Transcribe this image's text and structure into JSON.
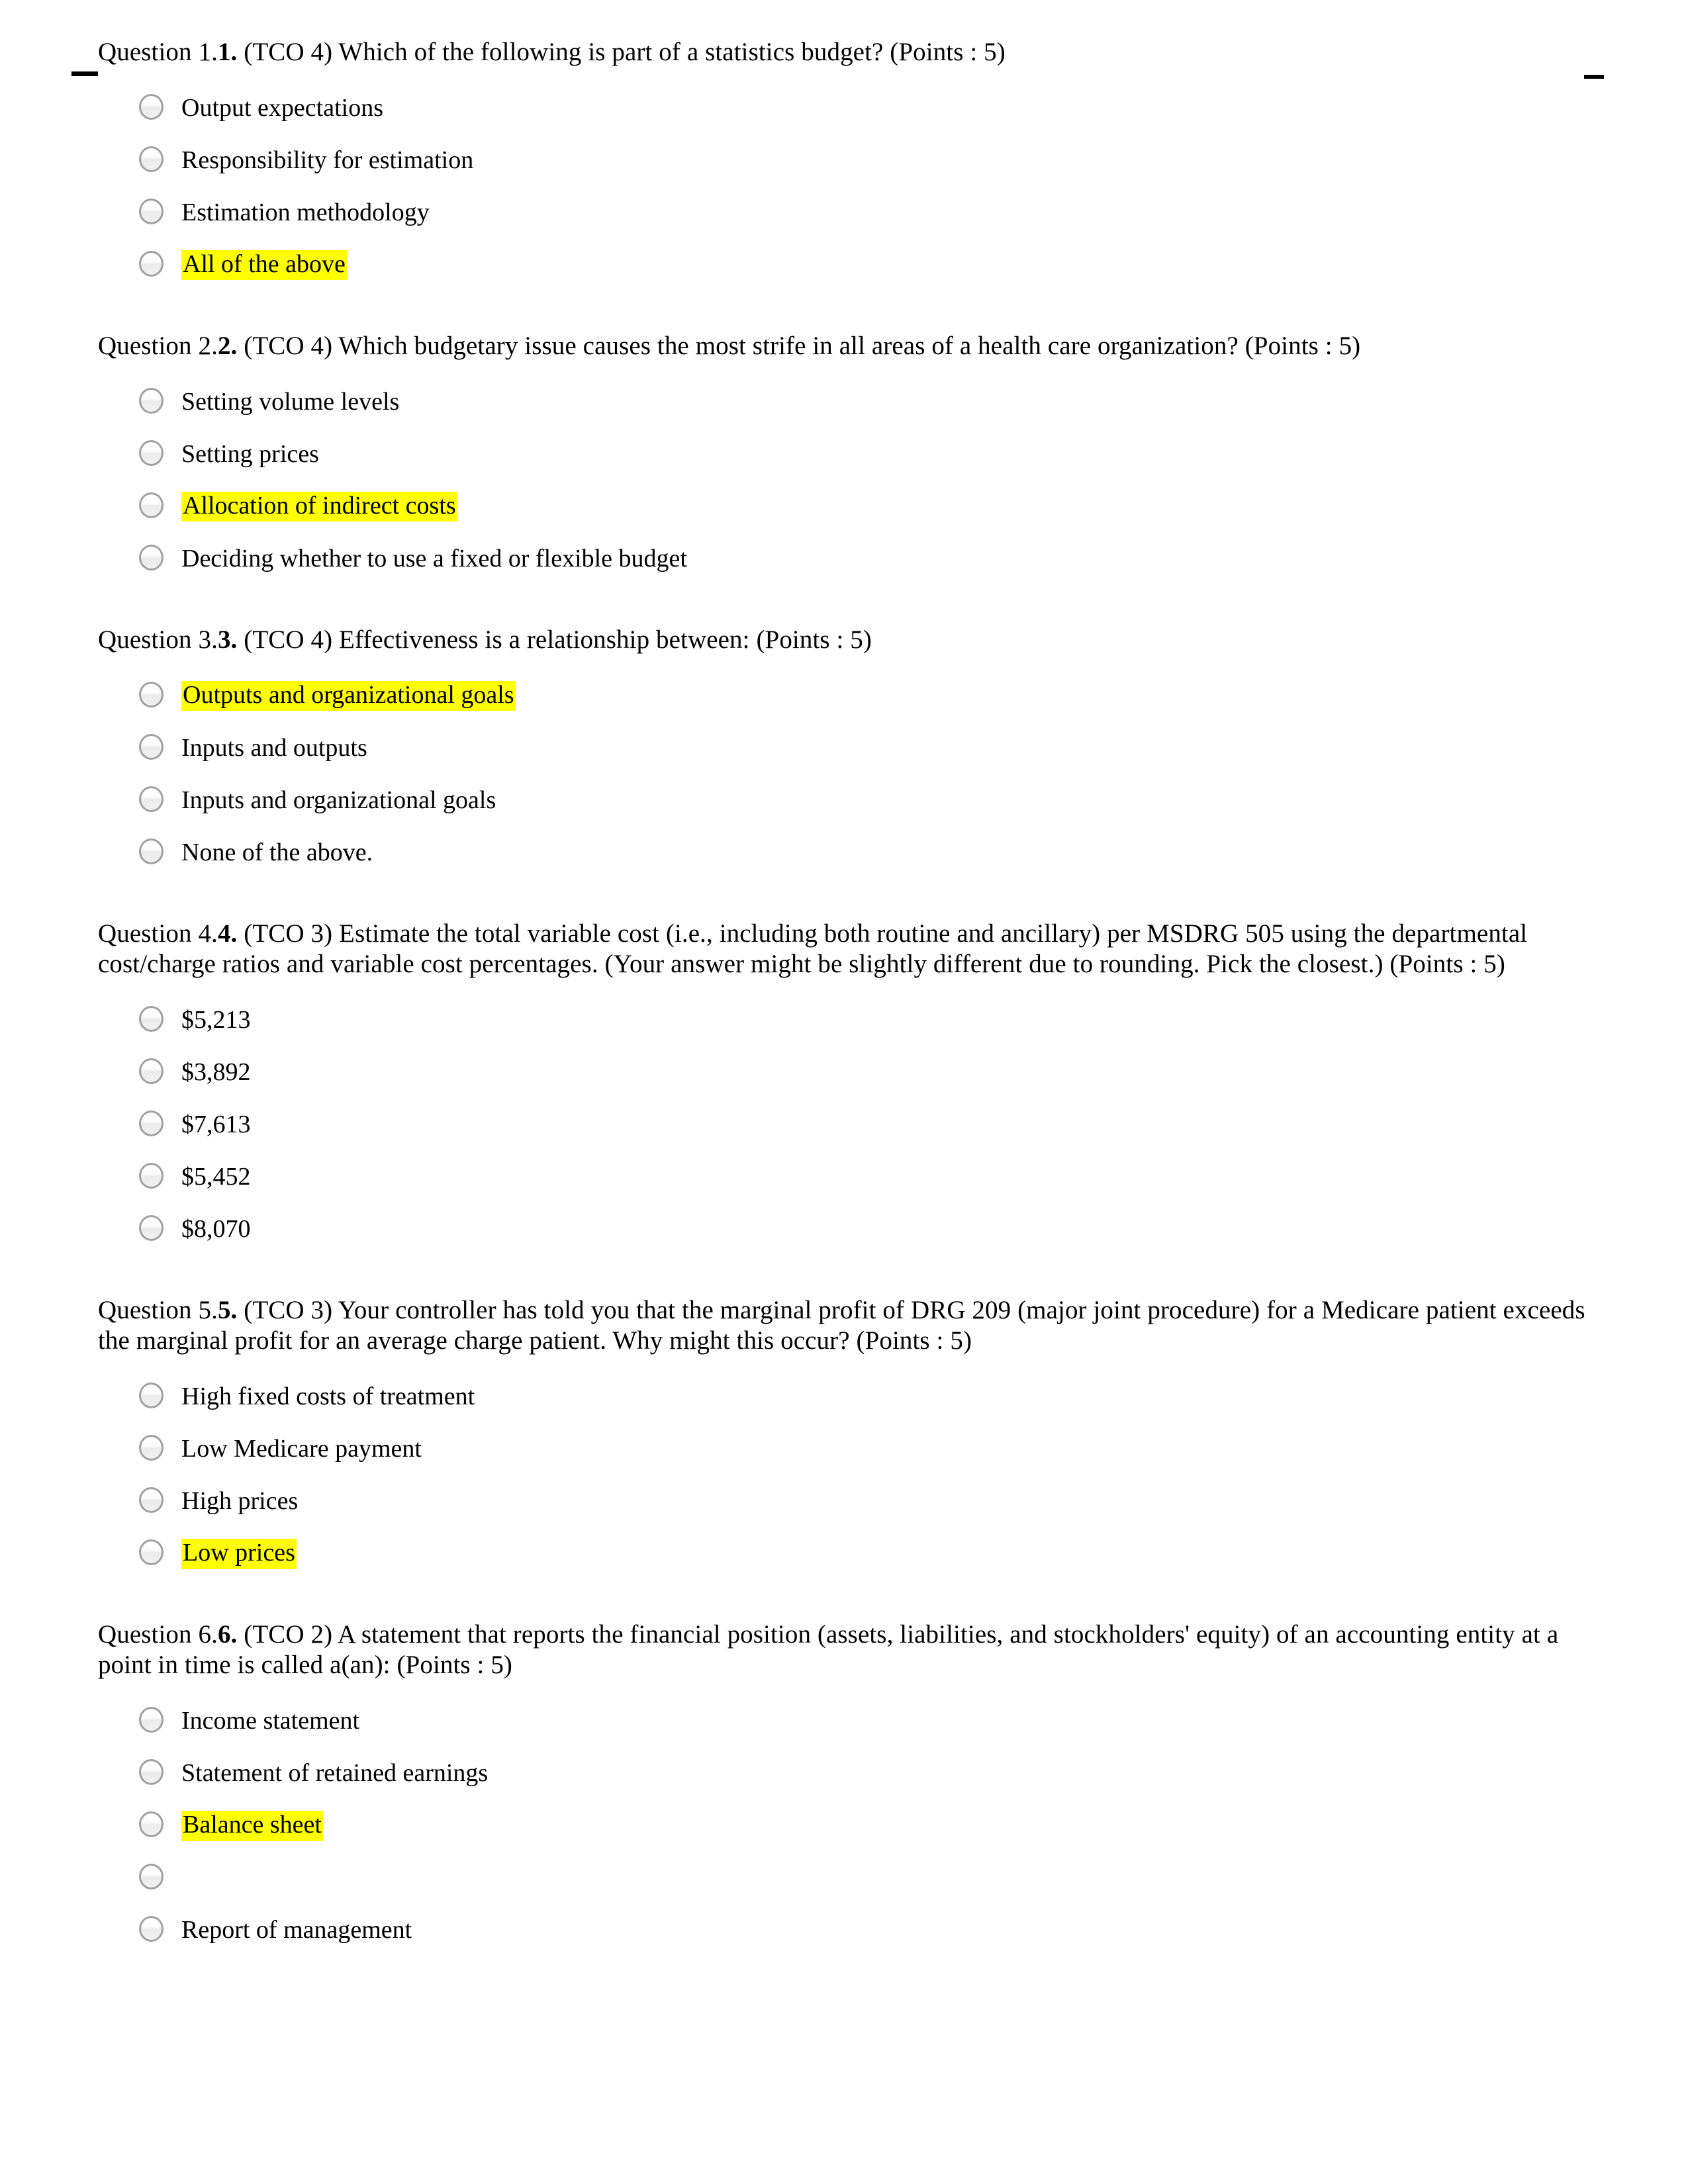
{
  "document": {
    "type": "multiple-choice-quiz",
    "highlight_color": "#ffff00",
    "text_color": "#000000",
    "background_color": "#ffffff"
  },
  "marks": {
    "left_dash": "_",
    "right_dash": "_"
  },
  "questions": [
    {
      "label": "Question 1.",
      "number": "1.",
      "prompt": " (TCO 4) Which of the following is part of a statistics budget? (Points : 5)",
      "options": [
        {
          "text": "Output expectations",
          "highlighted": false
        },
        {
          "text": "Responsibility for estimation",
          "highlighted": false
        },
        {
          "text": "Estimation methodology",
          "highlighted": false
        },
        {
          "text": "All of the above",
          "highlighted": true
        }
      ]
    },
    {
      "label": "Question 2.",
      "number": "2.",
      "prompt": " (TCO 4) Which budgetary issue causes the most strife in all areas of a health care organization? (Points : 5)",
      "options": [
        {
          "text": "Setting volume levels",
          "highlighted": false
        },
        {
          "text": "Setting prices",
          "highlighted": false
        },
        {
          "text": "Allocation of indirect costs",
          "highlighted": true
        },
        {
          "text": "Deciding whether to use a fixed or flexible budget",
          "highlighted": false
        }
      ]
    },
    {
      "label": "Question 3.",
      "number": "3.",
      "prompt": " (TCO 4) Effectiveness is a relationship between: (Points : 5)",
      "options": [
        {
          "text": "Outputs and organizational goals",
          "highlighted": true
        },
        {
          "text": "Inputs and outputs",
          "highlighted": false
        },
        {
          "text": "Inputs and organizational goals",
          "highlighted": false
        },
        {
          "text": "None of the above.",
          "highlighted": false
        }
      ]
    },
    {
      "label": "Question 4.",
      "number": "4.",
      "prompt": " (TCO 3) Estimate the total variable cost (i.e., including both routine and ancillary) per MSDRG 505 using the departmental cost/charge ratios and variable cost percentages. (Your answer might be slightly different due to rounding. Pick the closest.) (Points : 5)",
      "options": [
        {
          "text": "$5,213",
          "highlighted": false
        },
        {
          "text": "$3,892",
          "highlighted": false
        },
        {
          "text": "$7,613",
          "highlighted": false
        },
        {
          "text": "$5,452",
          "highlighted": false
        },
        {
          "text": "$8,070",
          "highlighted": false
        }
      ]
    },
    {
      "label": "Question 5.",
      "number": "5.",
      "prompt": " (TCO 3) Your controller has told you that the marginal profit of DRG 209 (major joint procedure) for a Medicare patient exceeds the marginal profit for an average charge patient. Why might this occur? (Points : 5)",
      "options": [
        {
          "text": "High fixed costs of treatment",
          "highlighted": false
        },
        {
          "text": "Low Medicare payment",
          "highlighted": false
        },
        {
          "text": "High prices",
          "highlighted": false
        },
        {
          "text": "Low prices",
          "highlighted": true
        }
      ]
    },
    {
      "label": "Question 6.",
      "number": "6.",
      "prompt": " (TCO 2) A statement that reports the financial position (assets, liabilities, and stockholders' equity) of an accounting entity at a point in time is called a(an): (Points : 5)",
      "options": [
        {
          "text": "Income statement",
          "highlighted": false
        },
        {
          "text": "Statement of retained earnings",
          "highlighted": false
        },
        {
          "text": "Balance sheet",
          "highlighted": true
        },
        {
          "text": "",
          "highlighted": false
        },
        {
          "text": "Report of management",
          "highlighted": false
        }
      ]
    }
  ]
}
